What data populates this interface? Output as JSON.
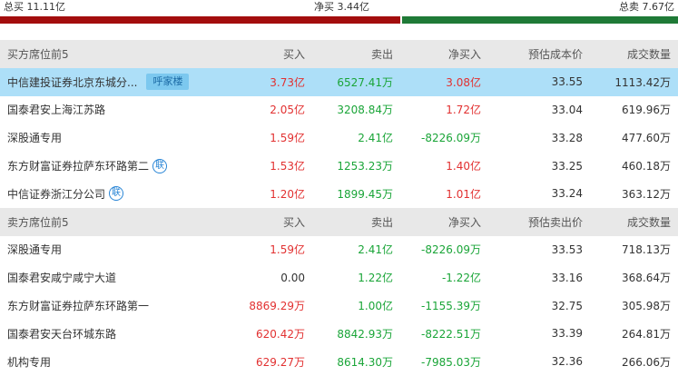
{
  "summary": {
    "total_buy": "总买 11.11亿",
    "net_buy": "净买 3.44亿",
    "total_sell": "总卖 7.67亿"
  },
  "buy_section": {
    "headers": [
      "买方席位前5",
      "买入",
      "卖出",
      "净买入",
      "预估成本价",
      "成交数量"
    ],
    "rows": [
      {
        "name": "中信建投证券北京东城分...",
        "tag": "呼家楼",
        "buy": "3.73亿",
        "sell": "6527.41万",
        "net": "3.08亿",
        "price": "33.55",
        "volume": "1113.42万"
      },
      {
        "name": "国泰君安上海江苏路",
        "buy": "2.05亿",
        "sell": "3208.84万",
        "net": "1.72亿",
        "price": "33.04",
        "volume": "619.96万"
      },
      {
        "name": "深股通专用",
        "buy": "1.59亿",
        "sell": "2.41亿",
        "net": "-8226.09万",
        "price": "33.28",
        "volume": "477.60万"
      },
      {
        "name": "东方财富证券拉萨东环路第二",
        "icon": "联",
        "buy": "1.53亿",
        "sell": "1253.23万",
        "net": "1.40亿",
        "price": "33.25",
        "volume": "460.18万"
      },
      {
        "name": "中信证券浙江分公司",
        "icon": "联",
        "buy": "1.20亿",
        "sell": "1899.45万",
        "net": "1.01亿",
        "price": "33.24",
        "volume": "363.12万"
      }
    ]
  },
  "sell_section": {
    "headers": [
      "卖方席位前5",
      "买入",
      "卖出",
      "净买入",
      "预估卖出价",
      "成交数量"
    ],
    "rows": [
      {
        "name": "深股通专用",
        "buy": "1.59亿",
        "sell": "2.41亿",
        "net": "-8226.09万",
        "price": "33.53",
        "volume": "718.13万"
      },
      {
        "name": "国泰君安咸宁咸宁大道",
        "buy": "0.00",
        "sell": "1.22亿",
        "net": "-1.22亿",
        "price": "33.16",
        "volume": "368.64万"
      },
      {
        "name": "东方财富证券拉萨东环路第一",
        "buy": "8869.29万",
        "sell": "1.00亿",
        "net": "-1155.39万",
        "price": "32.75",
        "volume": "305.98万"
      },
      {
        "name": "国泰君安天台环城东路",
        "buy": "620.42万",
        "sell": "8842.93万",
        "net": "-8222.51万",
        "price": "33.39",
        "volume": "264.81万"
      },
      {
        "name": "机构专用",
        "buy": "629.27万",
        "sell": "8614.30万",
        "net": "-7985.03万",
        "price": "32.36",
        "volume": "266.06万"
      }
    ]
  },
  "colors": {
    "red": "#e23131",
    "green": "#1aa538",
    "bar_red": "#a30d0d",
    "bar_green": "#1f7a37",
    "selected_row": "#addff8"
  }
}
